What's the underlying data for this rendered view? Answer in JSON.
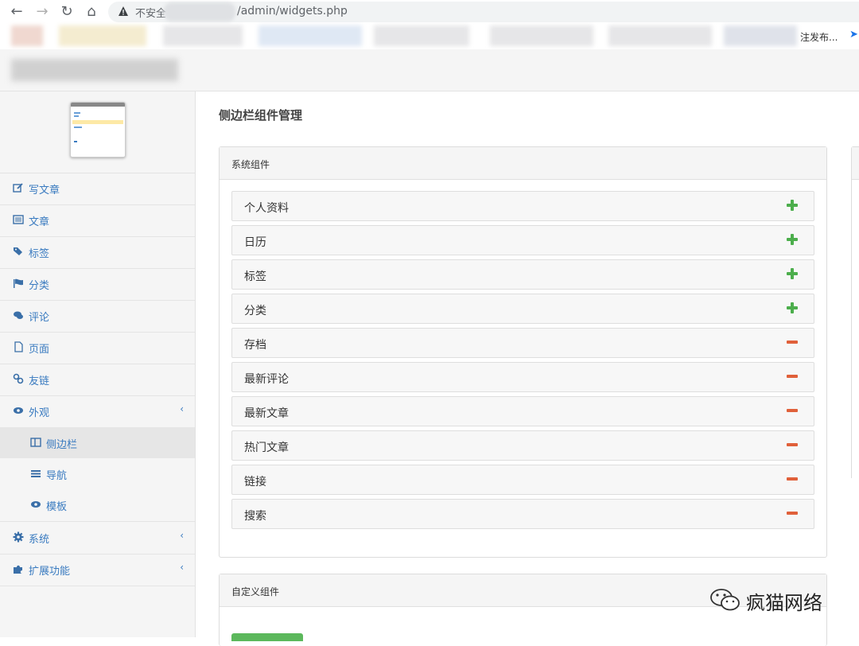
{
  "browser": {
    "security_label": "不安全",
    "url": "/admin/widgets.php",
    "bookmark_partial": "注发布..."
  },
  "sidebar": {
    "items": [
      {
        "label": "写文章",
        "icon": "edit-icon"
      },
      {
        "label": "文章",
        "icon": "list-icon"
      },
      {
        "label": "标签",
        "icon": "tags-icon"
      },
      {
        "label": "分类",
        "icon": "flag-icon"
      },
      {
        "label": "评论",
        "icon": "comments-icon"
      },
      {
        "label": "页面",
        "icon": "file-icon"
      },
      {
        "label": "友链",
        "icon": "link-icon"
      },
      {
        "label": "外观",
        "icon": "eye-icon",
        "expandable": true
      }
    ],
    "sub_items": [
      {
        "label": "侧边栏",
        "icon": "columns-icon",
        "active": true
      },
      {
        "label": "导航",
        "icon": "bars-icon"
      },
      {
        "label": "模板",
        "icon": "eye-icon"
      }
    ],
    "bottom_items": [
      {
        "label": "系统",
        "icon": "gear-icon",
        "expandable": true
      },
      {
        "label": "扩展功能",
        "icon": "puzzle-icon",
        "expandable": true
      }
    ]
  },
  "main": {
    "page_title": "侧边栏组件管理",
    "system_panel": {
      "title": "系统组件",
      "widgets": [
        {
          "label": "个人资料",
          "action": "add"
        },
        {
          "label": "日历",
          "action": "add"
        },
        {
          "label": "标签",
          "action": "add"
        },
        {
          "label": "分类",
          "action": "add"
        },
        {
          "label": "存档",
          "action": "remove"
        },
        {
          "label": "最新评论",
          "action": "remove"
        },
        {
          "label": "最新文章",
          "action": "remove"
        },
        {
          "label": "热门文章",
          "action": "remove"
        },
        {
          "label": "链接",
          "action": "remove"
        },
        {
          "label": "搜索",
          "action": "remove"
        }
      ]
    },
    "custom_panel": {
      "title": "自定义组件"
    }
  },
  "watermark": {
    "text": "疯猫网络"
  },
  "colors": {
    "add": "#4cae4c",
    "remove": "#e0603a",
    "link": "#3a7bc0",
    "primary_button": "#5cb85c"
  }
}
